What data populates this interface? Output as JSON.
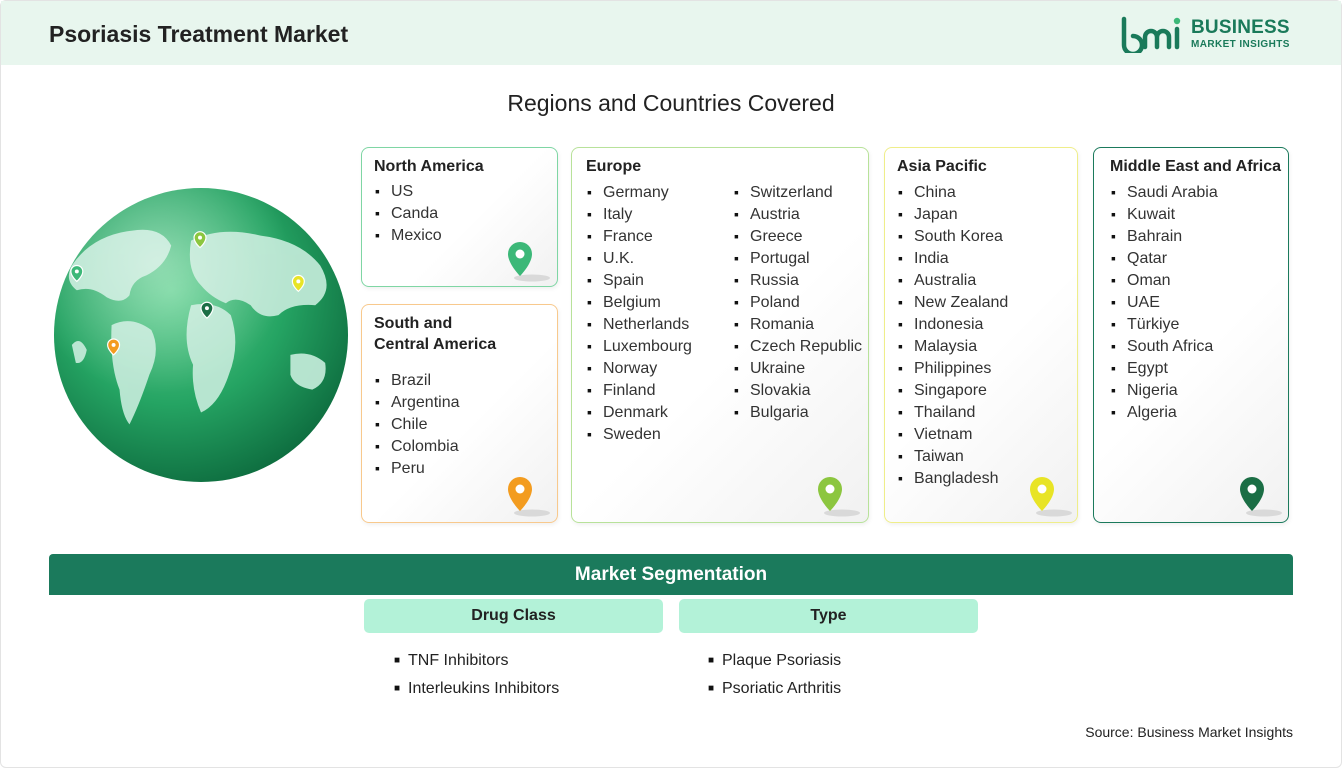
{
  "header": {
    "title": "Psoriasis Treatment Market",
    "logo_line1": "BUSINESS",
    "logo_line2": "MARKET INSIGHTS",
    "logo_mark": "bmi"
  },
  "regions_title": "Regions and Countries Covered",
  "regions": {
    "north_america": {
      "title": "North America",
      "items": [
        "US",
        "Canda",
        "Mexico"
      ],
      "pin_color": "#3cb878"
    },
    "south_america": {
      "title_line1": "South and",
      "title_line2": "Central America",
      "items": [
        "Brazil",
        "Argentina",
        "Chile",
        "Colombia",
        "Peru"
      ],
      "pin_color": "#f39c1f"
    },
    "europe": {
      "title": "Europe",
      "col1": [
        "Germany",
        "Italy",
        "France",
        "U.K.",
        "Spain",
        "Belgium",
        "Netherlands",
        "Luxembourg",
        "Norway",
        "Finland",
        "Denmark",
        "Sweden"
      ],
      "col2": [
        "Switzerland",
        "Austria",
        "Greece",
        "Portugal",
        "Russia",
        "Poland",
        "Romania",
        "Czech Republic",
        "Ukraine",
        "Slovakia",
        "Bulgaria"
      ],
      "pin_color": "#8cc63f"
    },
    "asia_pacific": {
      "title": "Asia Pacific",
      "items": [
        "China",
        "Japan",
        "South Korea",
        "India",
        "Australia",
        "New Zealand",
        "Indonesia",
        "Malaysia",
        "Philippines",
        "Singapore",
        "Thailand",
        "Vietnam",
        "Taiwan",
        "Bangladesh"
      ],
      "pin_color": "#e8e426"
    },
    "mea": {
      "title": "Middle East and Africa",
      "items": [
        "Saudi Arabia",
        "Kuwait",
        "Bahrain",
        "Qatar",
        "Oman",
        "UAE",
        "Türkiye",
        "South Africa",
        "Egypt",
        "Nigeria",
        "Algeria"
      ],
      "pin_color": "#1b6e45"
    }
  },
  "segmentation": {
    "title": "Market Segmentation",
    "drug_class": {
      "heading": "Drug Class",
      "items": [
        "TNF Inhibitors",
        "Interleukins Inhibitors"
      ]
    },
    "type": {
      "heading": "Type",
      "items": [
        "Plaque Psoriasis",
        "Psoriatic Arthritis"
      ]
    }
  },
  "source": "Source: Business Market Insights",
  "colors": {
    "header_bg": "#e8f6ee",
    "brand_green": "#1b7a5c",
    "segment_head_bg": "#b3f2d8"
  }
}
